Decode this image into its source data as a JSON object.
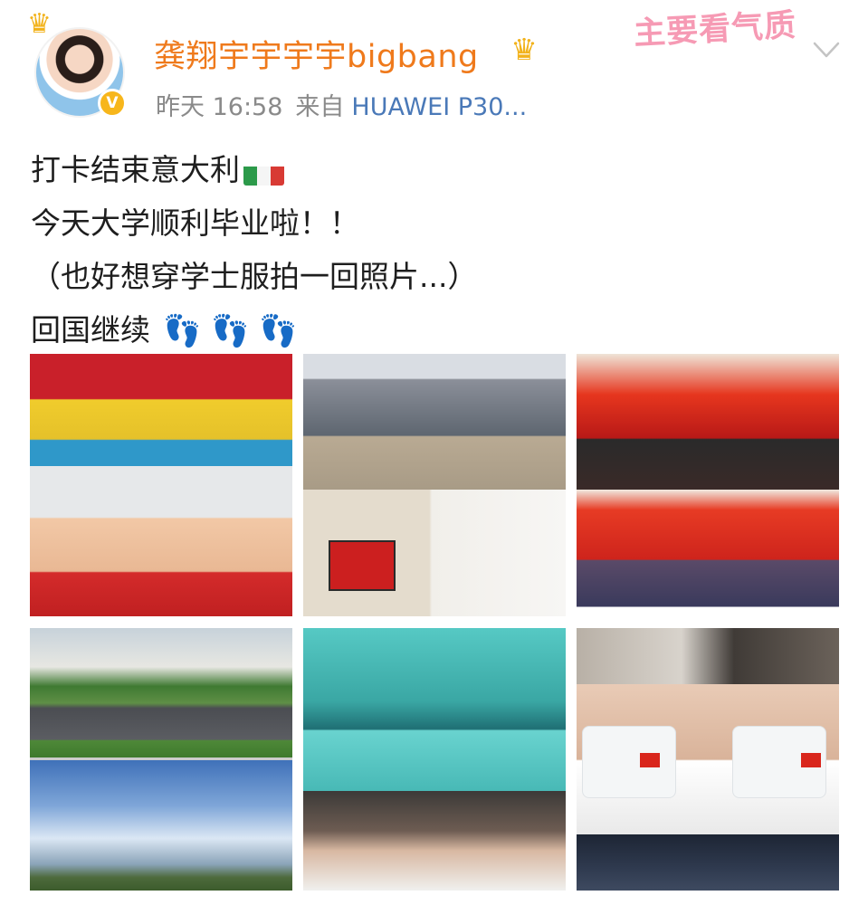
{
  "header": {
    "username": "龚翔宇宇宇宇bigbang",
    "timestamp": "昨天 16:58",
    "source_prefix": "来自",
    "device": "HUAWEI P30...",
    "sticker_text": "主要看气质",
    "verified_badge": "V"
  },
  "post": {
    "line1": "打卡结束意大利",
    "line2": "今天大学顺利毕业啦！！",
    "line3": "（也好想穿学士服拍一回照片...）",
    "line4": "回国继续",
    "line4_emoji": "👣 👣 👣"
  },
  "icons": {
    "crown_left": "crown-icon",
    "crown_badge": "member-crown-icon",
    "flag": "italy-flag-icon",
    "footprints": "footprints-icon",
    "more": "chevron-down-icon"
  },
  "colors": {
    "username": "#ef7a1c",
    "meta": "#8a8a8a",
    "device": "#4a79b8",
    "sticker": "#f69ab4",
    "badge": "#f7b61b"
  },
  "images": [
    {
      "name": "team-and-selfie-photo"
    },
    {
      "name": "venue-and-room-photo"
    },
    {
      "name": "graduation-ceremony-photo"
    },
    {
      "name": "landscape-photo"
    },
    {
      "name": "mirror-and-elevator-selfie-photo"
    },
    {
      "name": "masked-selfie-photo"
    }
  ]
}
